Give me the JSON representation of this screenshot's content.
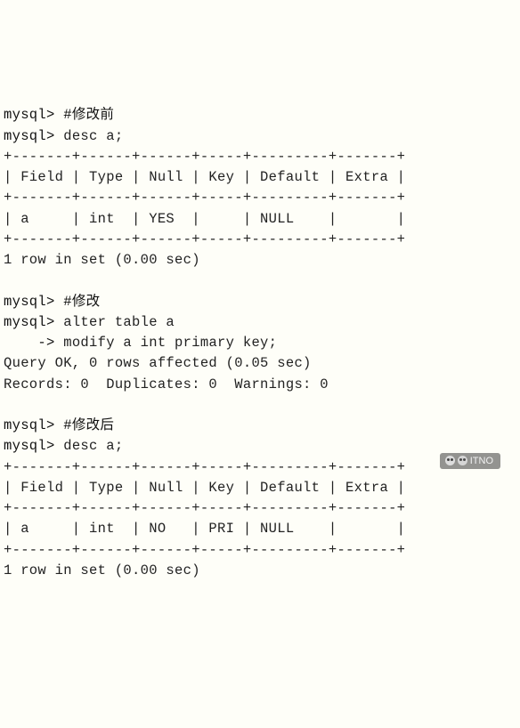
{
  "session": {
    "prompt": "mysql>",
    "cont_prompt": "    ->",
    "lines": {
      "comment1": "#修改前",
      "cmd1": "desc a;",
      "tbl1_border": "+-------+------+------+-----+---------+-------+",
      "tbl1_header": "| Field | Type | Null | Key | Default | Extra |",
      "tbl1_row": "| a     | int  | YES  |     | NULL    |       |",
      "rows1": "1 row in set (0.00 sec)",
      "comment2": "#修改",
      "cmd2": "alter table a",
      "cmd2b": "modify a int primary key;",
      "result2a": "Query OK, 0 rows affected (0.05 sec)",
      "result2b": "Records: 0  Duplicates: 0  Warnings: 0",
      "comment3": "#修改后",
      "cmd3": "desc a;",
      "tbl2_border": "+-------+------+------+-----+---------+-------+",
      "tbl2_header": "| Field | Type | Null | Key | Default | Extra |",
      "tbl2_row": "| a     | int  | NO   | PRI | NULL    |       |",
      "rows2": "1 row in set (0.00 sec)"
    }
  },
  "watermark": {
    "text": "ITNO"
  }
}
